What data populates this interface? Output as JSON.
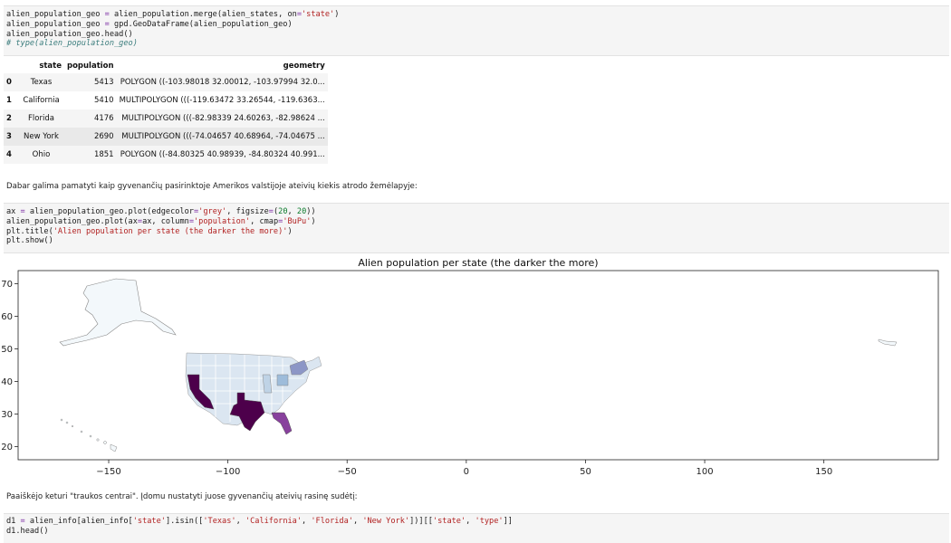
{
  "cell1": {
    "lines": [
      [
        [
          "alien_population_geo ",
          "kw"
        ],
        [
          "=",
          "op"
        ],
        [
          " alien_population.merge(alien_states, on",
          "kw"
        ],
        [
          "=",
          "op"
        ],
        [
          "'state'",
          "str"
        ],
        [
          ")",
          "kw"
        ]
      ],
      [
        [
          "alien_population_geo ",
          "kw"
        ],
        [
          "=",
          "op"
        ],
        [
          " gpd.GeoDataFrame(alien_population_geo)",
          "kw"
        ]
      ],
      [
        [
          "alien_population_geo.head()",
          "kw"
        ]
      ],
      [
        [
          "# type(alien_population_geo)",
          "cmt"
        ]
      ]
    ]
  },
  "table": {
    "headers": [
      "",
      "state",
      "population",
      "geometry"
    ],
    "rows": [
      [
        "0",
        "Texas",
        "5413",
        "POLYGON ((-103.98018 32.00012, -103.97994 32.0..."
      ],
      [
        "1",
        "California",
        "5410",
        "MULTIPOLYGON (((-119.63472 33.26544, -119.6363..."
      ],
      [
        "2",
        "Florida",
        "4176",
        "MULTIPOLYGON (((-82.98339 24.60263, -82.98624 ..."
      ],
      [
        "3",
        "New York",
        "2690",
        "MULTIPOLYGON (((-74.04657 40.68964, -74.04675 ..."
      ],
      [
        "4",
        "Ohio",
        "1851",
        "POLYGON ((-84.80325 40.98939, -84.80324 40.991..."
      ]
    ]
  },
  "md1": "Dabar galima pamatyti kaip gyvenančių pasirinktoje Amerikos valstijoje ateivių kiekis atrodo žemėlapyje:",
  "cell2": {
    "lines": [
      [
        [
          "ax ",
          "kw"
        ],
        [
          "=",
          "op"
        ],
        [
          " alien_population_geo.plot(edgecolor",
          "kw"
        ],
        [
          "=",
          "op"
        ],
        [
          "'grey'",
          "str"
        ],
        [
          ", figsize",
          "kw"
        ],
        [
          "=",
          "op"
        ],
        [
          "(",
          "kw"
        ],
        [
          "20",
          "num"
        ],
        [
          ", ",
          "kw"
        ],
        [
          "20",
          "num"
        ],
        [
          "))",
          "kw"
        ]
      ],
      [
        [
          "alien_population_geo.plot(ax",
          "kw"
        ],
        [
          "=",
          "op"
        ],
        [
          "ax, column",
          "kw"
        ],
        [
          "=",
          "op"
        ],
        [
          "'population'",
          "str"
        ],
        [
          ", cmap",
          "kw"
        ],
        [
          "=",
          "op"
        ],
        [
          "'BuPu'",
          "str"
        ],
        [
          ")",
          "kw"
        ]
      ],
      [
        [
          "plt.title(",
          "kw"
        ],
        [
          "'Alien population per state (the darker the more)'",
          "str"
        ],
        [
          ")",
          "kw"
        ]
      ],
      [
        [
          "plt.show()",
          "kw"
        ]
      ]
    ]
  },
  "chart_data": {
    "type": "map",
    "title": "Alien population per state (the darker the more)",
    "xlim": [
      -188,
      198
    ],
    "ylim": [
      16,
      74
    ],
    "xticks": [
      "−150",
      "−100",
      "−50",
      "0",
      "50",
      "100",
      "150"
    ],
    "xtick_values": [
      -150,
      -100,
      -50,
      0,
      50,
      100,
      150
    ],
    "yticks": [
      "20",
      "30",
      "40",
      "50",
      "60",
      "70"
    ],
    "ytick_values": [
      20,
      30,
      40,
      50,
      60,
      70
    ],
    "cmap": "BuPu",
    "edgecolor": "grey",
    "colors": {
      "max": "#4d004b",
      "high": "#88419d",
      "mid": "#8c96c6",
      "low": "#dbe6f1",
      "min": "#f7fcfd"
    },
    "highlighted_states": [
      {
        "state": "Texas",
        "population": 5413
      },
      {
        "state": "California",
        "population": 5410
      },
      {
        "state": "Florida",
        "population": 4176
      },
      {
        "state": "New York",
        "population": 2690
      },
      {
        "state": "Ohio",
        "population": 1851
      }
    ]
  },
  "md2": "Paaiškėjo keturi \"traukos centrai\". Įdomu nustatyti juose gyvenančių ateivių rasinę sudėtį:",
  "cell3": {
    "lines": [
      [
        [
          "d1 ",
          "kw"
        ],
        [
          "=",
          "op"
        ],
        [
          " alien_info[alien_info[",
          "kw"
        ],
        [
          "'state'",
          "str"
        ],
        [
          "].isin([",
          "kw"
        ],
        [
          "'Texas'",
          "str"
        ],
        [
          ", ",
          "kw"
        ],
        [
          "'California'",
          "str"
        ],
        [
          ", ",
          "kw"
        ],
        [
          "'Florida'",
          "str"
        ],
        [
          ", ",
          "kw"
        ],
        [
          "'New York'",
          "str"
        ],
        [
          "])][[",
          "kw"
        ],
        [
          "'state'",
          "str"
        ],
        [
          ", ",
          "kw"
        ],
        [
          "'type'",
          "str"
        ],
        [
          "]]",
          "kw"
        ]
      ],
      [
        [
          "d1.head()",
          "kw"
        ]
      ]
    ]
  }
}
